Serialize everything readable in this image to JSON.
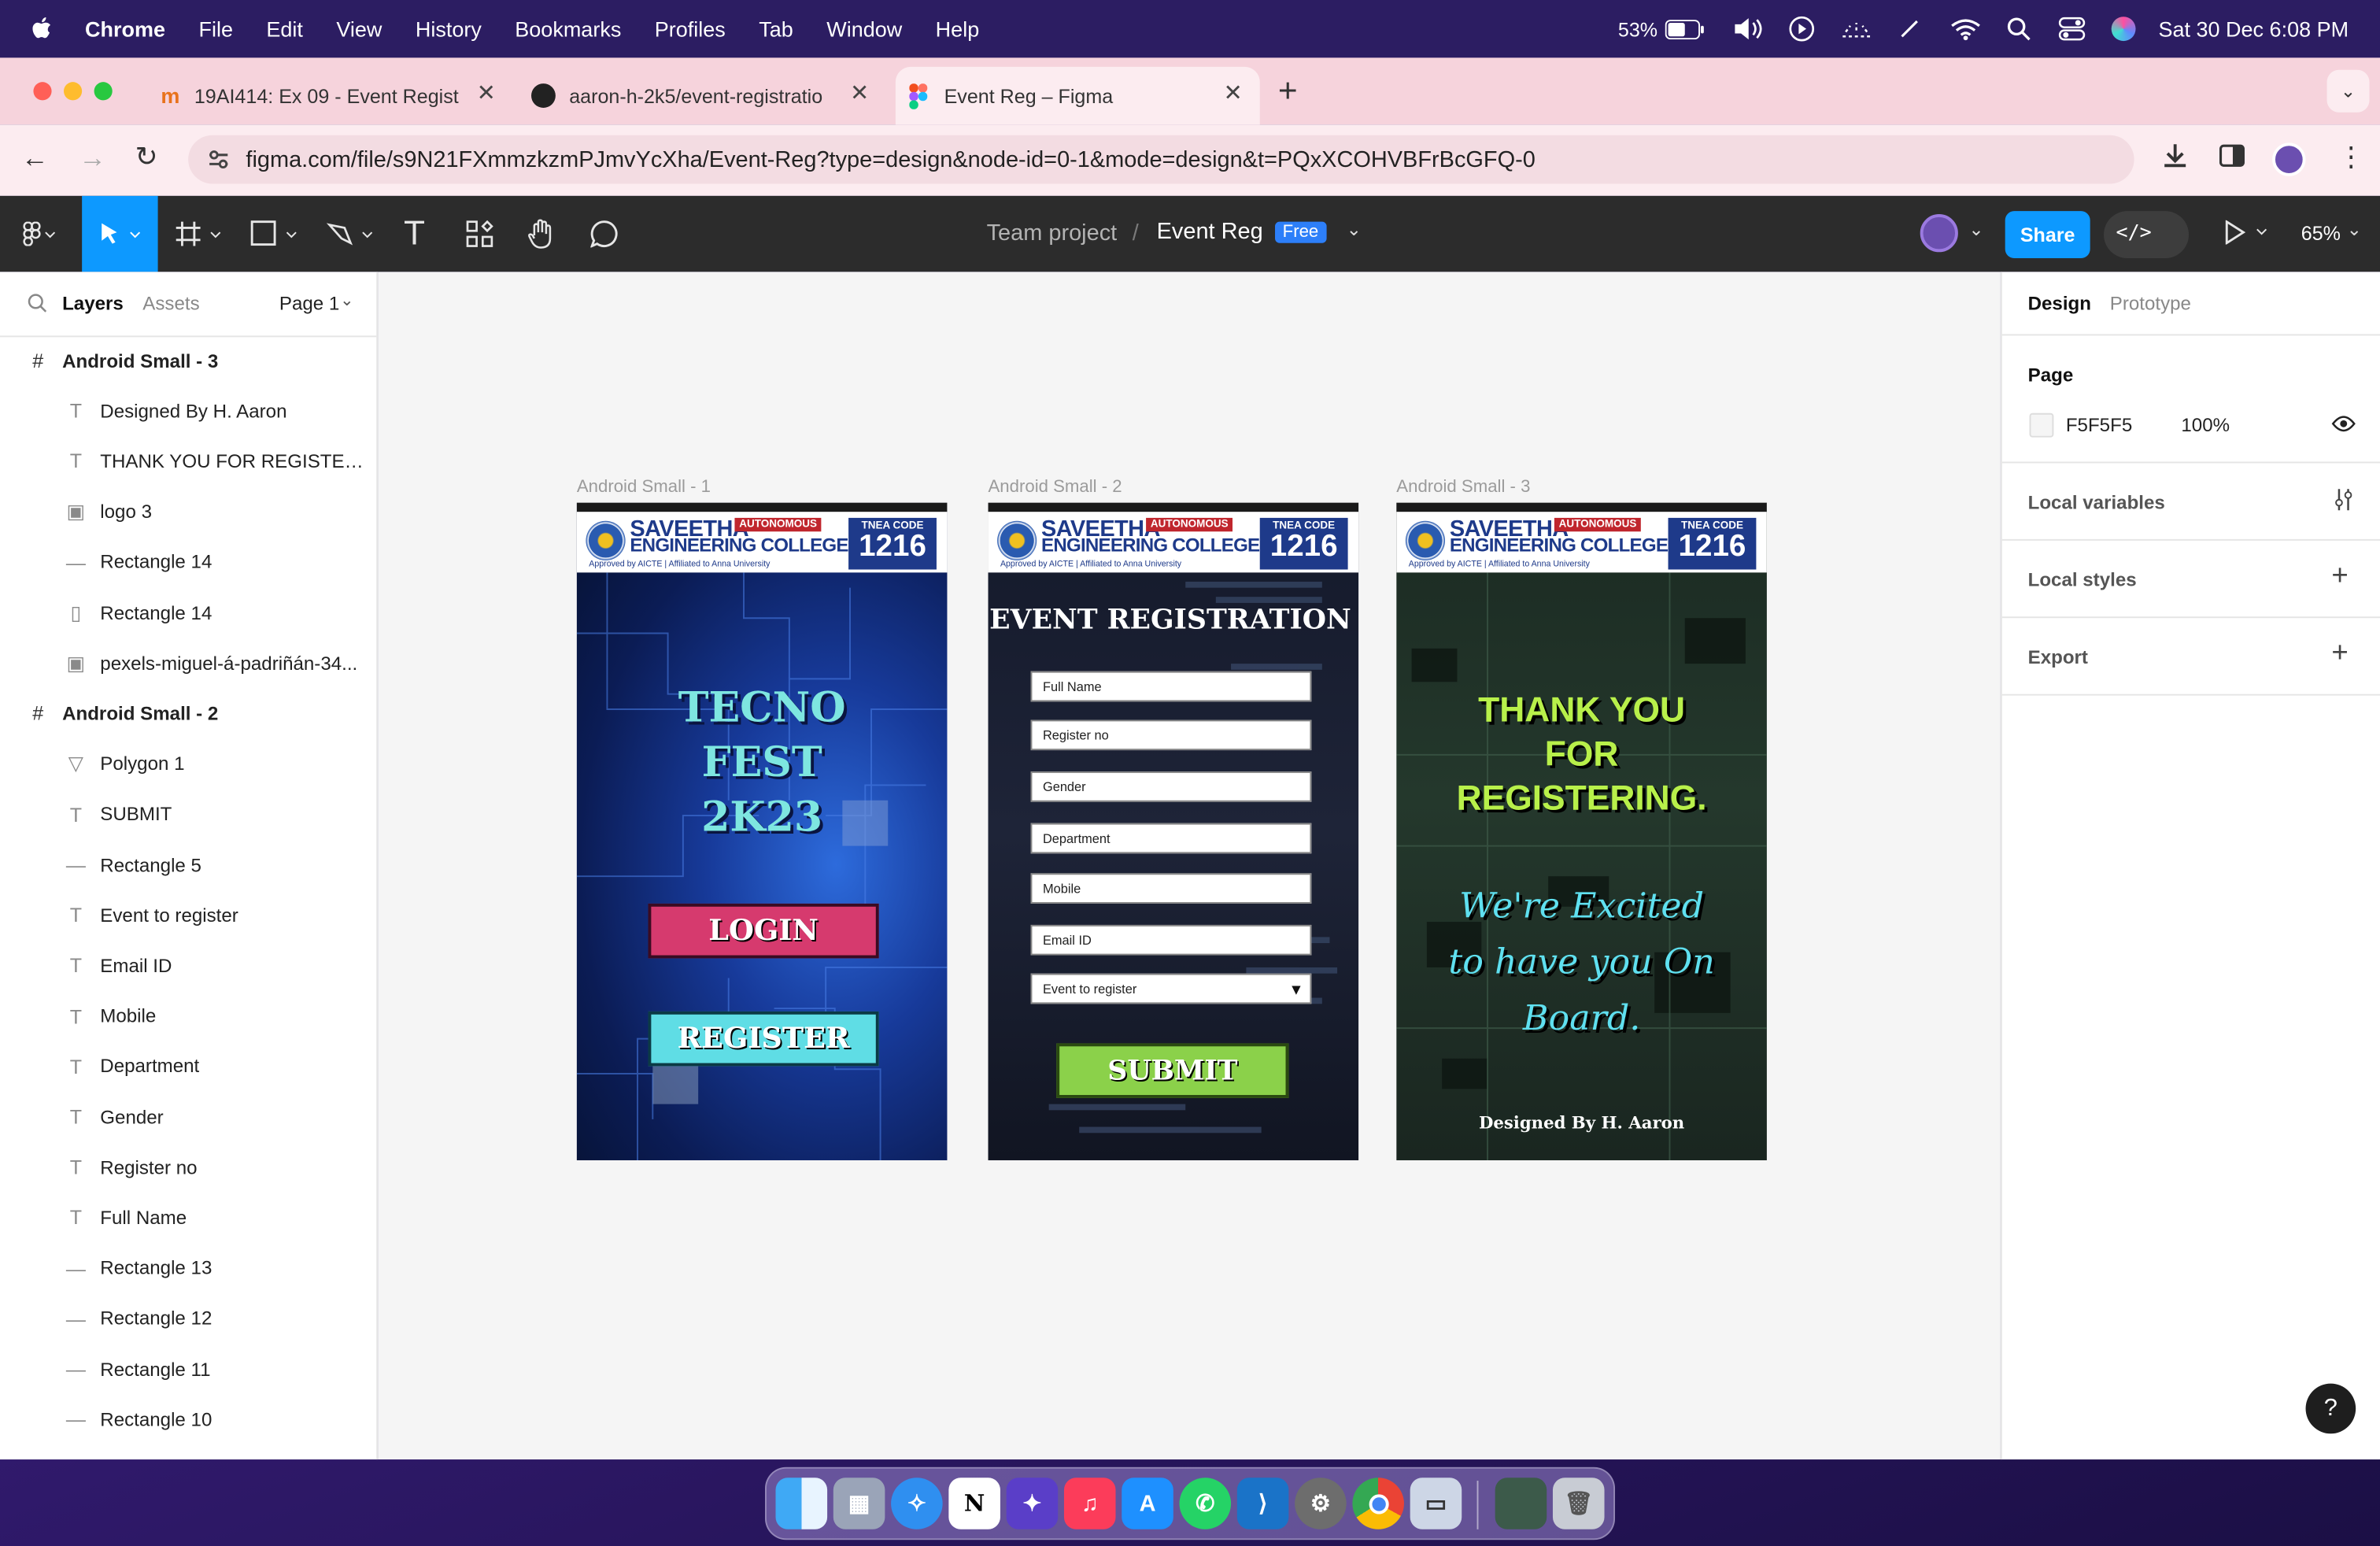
{
  "menubar": {
    "apple": "",
    "items": [
      "Chrome",
      "File",
      "Edit",
      "View",
      "History",
      "Bookmarks",
      "Profiles",
      "Tab",
      "Window",
      "Help"
    ],
    "battery": "53%",
    "datetime": "Sat 30 Dec  6:08 PM"
  },
  "browser": {
    "tabs": [
      {
        "title": "19AI414: Ex 09 - Event Regist",
        "icon": "moodle-icon"
      },
      {
        "title": "aaron-h-2k5/event-registratio",
        "icon": "github-icon"
      },
      {
        "title": "Event Reg – Figma",
        "icon": "figma-icon"
      }
    ],
    "url": "figma.com/file/s9N21FXmmzkzmPJmvYcXha/Event-Reg?type=design&node-id=0-1&mode=design&t=PQxXCOHVBFrBcGFQ-0"
  },
  "figma": {
    "project": "Team project",
    "separator": "/",
    "file": "Event Reg",
    "plan_badge": "Free",
    "share": "Share",
    "zoom": "65%"
  },
  "left_panel": {
    "tabs": [
      "Layers",
      "Assets"
    ],
    "page": "Page 1",
    "layers": [
      {
        "name": "Android Small - 3",
        "type": "frame"
      },
      {
        "name": "Designed By H. Aaron",
        "type": "text"
      },
      {
        "name": "THANK YOU FOR REGISTERI...",
        "type": "text"
      },
      {
        "name": "logo 3",
        "type": "image"
      },
      {
        "name": "Rectangle 14",
        "type": "line"
      },
      {
        "name": "Rectangle 14",
        "type": "rect"
      },
      {
        "name": "pexels-miguel-á-padriñán-34...",
        "type": "image"
      },
      {
        "name": "Android Small - 2",
        "type": "frame"
      },
      {
        "name": "Polygon 1",
        "type": "polygon"
      },
      {
        "name": "SUBMIT",
        "type": "text"
      },
      {
        "name": "Rectangle 5",
        "type": "line"
      },
      {
        "name": "Event to register",
        "type": "text"
      },
      {
        "name": "Email ID",
        "type": "text"
      },
      {
        "name": "Mobile",
        "type": "text"
      },
      {
        "name": "Department",
        "type": "text"
      },
      {
        "name": "Gender",
        "type": "text"
      },
      {
        "name": "Register no",
        "type": "text"
      },
      {
        "name": "Full Name",
        "type": "text"
      },
      {
        "name": "Rectangle 13",
        "type": "line"
      },
      {
        "name": "Rectangle 12",
        "type": "line"
      },
      {
        "name": "Rectangle 11",
        "type": "line"
      },
      {
        "name": "Rectangle 10",
        "type": "line"
      }
    ]
  },
  "canvas": {
    "frame_labels": [
      "Android Small - 1",
      "Android Small - 2",
      "Android Small - 3"
    ],
    "header": {
      "college1": "SAVEETHA",
      "college2": "ENGINEERING COLLEGE",
      "autonomous": "AUTONOMOUS",
      "approval": "Approved by AICTE  |  Affiliated to Anna University",
      "code_label": "TNEA CODE",
      "code": "1216"
    },
    "frame1": {
      "title_lines": [
        "TECNO",
        "FEST",
        "2K23"
      ],
      "login": "LOGIN",
      "register": "REGISTER"
    },
    "frame2": {
      "title": "EVENT REGISTRATION",
      "fields": [
        "Full Name",
        "Register no",
        "Gender",
        "Department",
        "Mobile",
        "Email ID",
        "Event to register"
      ],
      "submit": "SUBMIT"
    },
    "frame3": {
      "thanks_lines": [
        "THANK YOU",
        "FOR",
        "REGISTERING."
      ],
      "excited_lines": [
        "We're Excited",
        "to have you On",
        "Board."
      ],
      "credit": "Designed By H. Aaron"
    }
  },
  "right_panel": {
    "tabs": [
      "Design",
      "Prototype"
    ],
    "page_heading": "Page",
    "page_color": "F5F5F5",
    "page_opacity": "100%",
    "sections": [
      "Local variables",
      "Local styles",
      "Export"
    ],
    "help": "?"
  },
  "colors": {
    "figma_blue": "#0d99ff",
    "login_pink": "#d63a6e",
    "register_cyan": "#5fdde5",
    "submit_green": "#8bd14a",
    "thanks_green": "#b8f04a",
    "excited_cyan": "#5fe0f0"
  }
}
